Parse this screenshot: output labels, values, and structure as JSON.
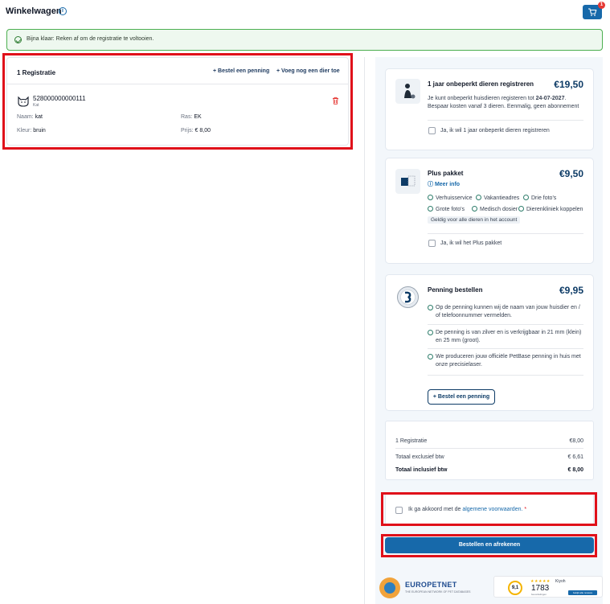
{
  "header": {
    "title": "Winkelwagen",
    "cart_count": "1"
  },
  "alert": {
    "text": "Bijna klaar: Reken af om de registratie te voltooien."
  },
  "registration": {
    "heading": "1 Registratie",
    "order_tag_link": "Bestel een penning",
    "add_pet_link": "Voeg nog een dier toe",
    "chip_number": "528000000000111",
    "species": "Kat",
    "name_label": "Naam:",
    "name_value": "kat",
    "breed_label": "Ras:",
    "breed_value": "EK",
    "color_label": "Kleur:",
    "color_value": "bruin",
    "price_label": "Prijs:",
    "price_value": "€ 8,00"
  },
  "offers": {
    "unlimited": {
      "title": "1 jaar onbeperkt dieren registreren",
      "price": "€19,50",
      "desc_part1": "Je kunt onbeperkt huisdieren registeren tot",
      "desc_date": "24-07-2027",
      "desc_part2": ". Bespaar kosten vanaf 3 dieren. Eenmalig, geen abonnement",
      "checkbox_label": "Ja, ik wil 1 jaar onbeperkt dieren registreren"
    },
    "plus": {
      "title": "Plus pakket",
      "price": "€9,50",
      "more_info": "Meer info",
      "features": [
        "Verhuisservice",
        "Vakantieadres",
        "Drie foto's",
        "Grote foto's",
        "Medisch dosier",
        "Dierenkliniek koppelen"
      ],
      "tag": "Geldig voor alle dieren in het account",
      "checkbox_label": "Ja, ik wil het Plus pakket"
    },
    "tag": {
      "title": "Penning bestellen",
      "price": "€9,95",
      "bullets": [
        "Op de penning kunnen wij de naam van jouw huisdier en / of telefoonnummer vermelden.",
        "De penning is van zilver en is verkrijgbaar in 21 mm (klein) en 25 mm (groot).",
        "We produceren jouw officiële PetBase penning in huis met onze precisielaser."
      ],
      "button": "Bestel een penning"
    }
  },
  "summary": {
    "row1_label": "1 Registratie",
    "row1_value": "€8,00",
    "excl_label": "Totaal exclusief btw",
    "excl_value": "€ 6,61",
    "incl_label": "Totaal inclusief btw",
    "incl_value": "€ 8,00"
  },
  "terms": {
    "prefix": "Ik ga akkoord met de",
    "link": "algemene voorwaarden.",
    "required": "*"
  },
  "checkout_button": "Bestellen en afrekenen",
  "footer": {
    "europetnet_name": "EUROPETNET",
    "europetnet_sub": "THE EUROPEAN NETWORK OF PET DATABASES",
    "kiyoh_score": "9,1",
    "kiyoh_stars": "★★★★★",
    "kiyoh_brand": "Kiyoh",
    "kiyoh_count": "1783",
    "kiyoh_sub": "beoordelingen",
    "kiyoh_button": "bekijk alle reviews"
  },
  "colors": {
    "primary": "#1769aa",
    "accent_red": "#e0101a",
    "success": "#4caf50",
    "price": "#0d3b66"
  }
}
